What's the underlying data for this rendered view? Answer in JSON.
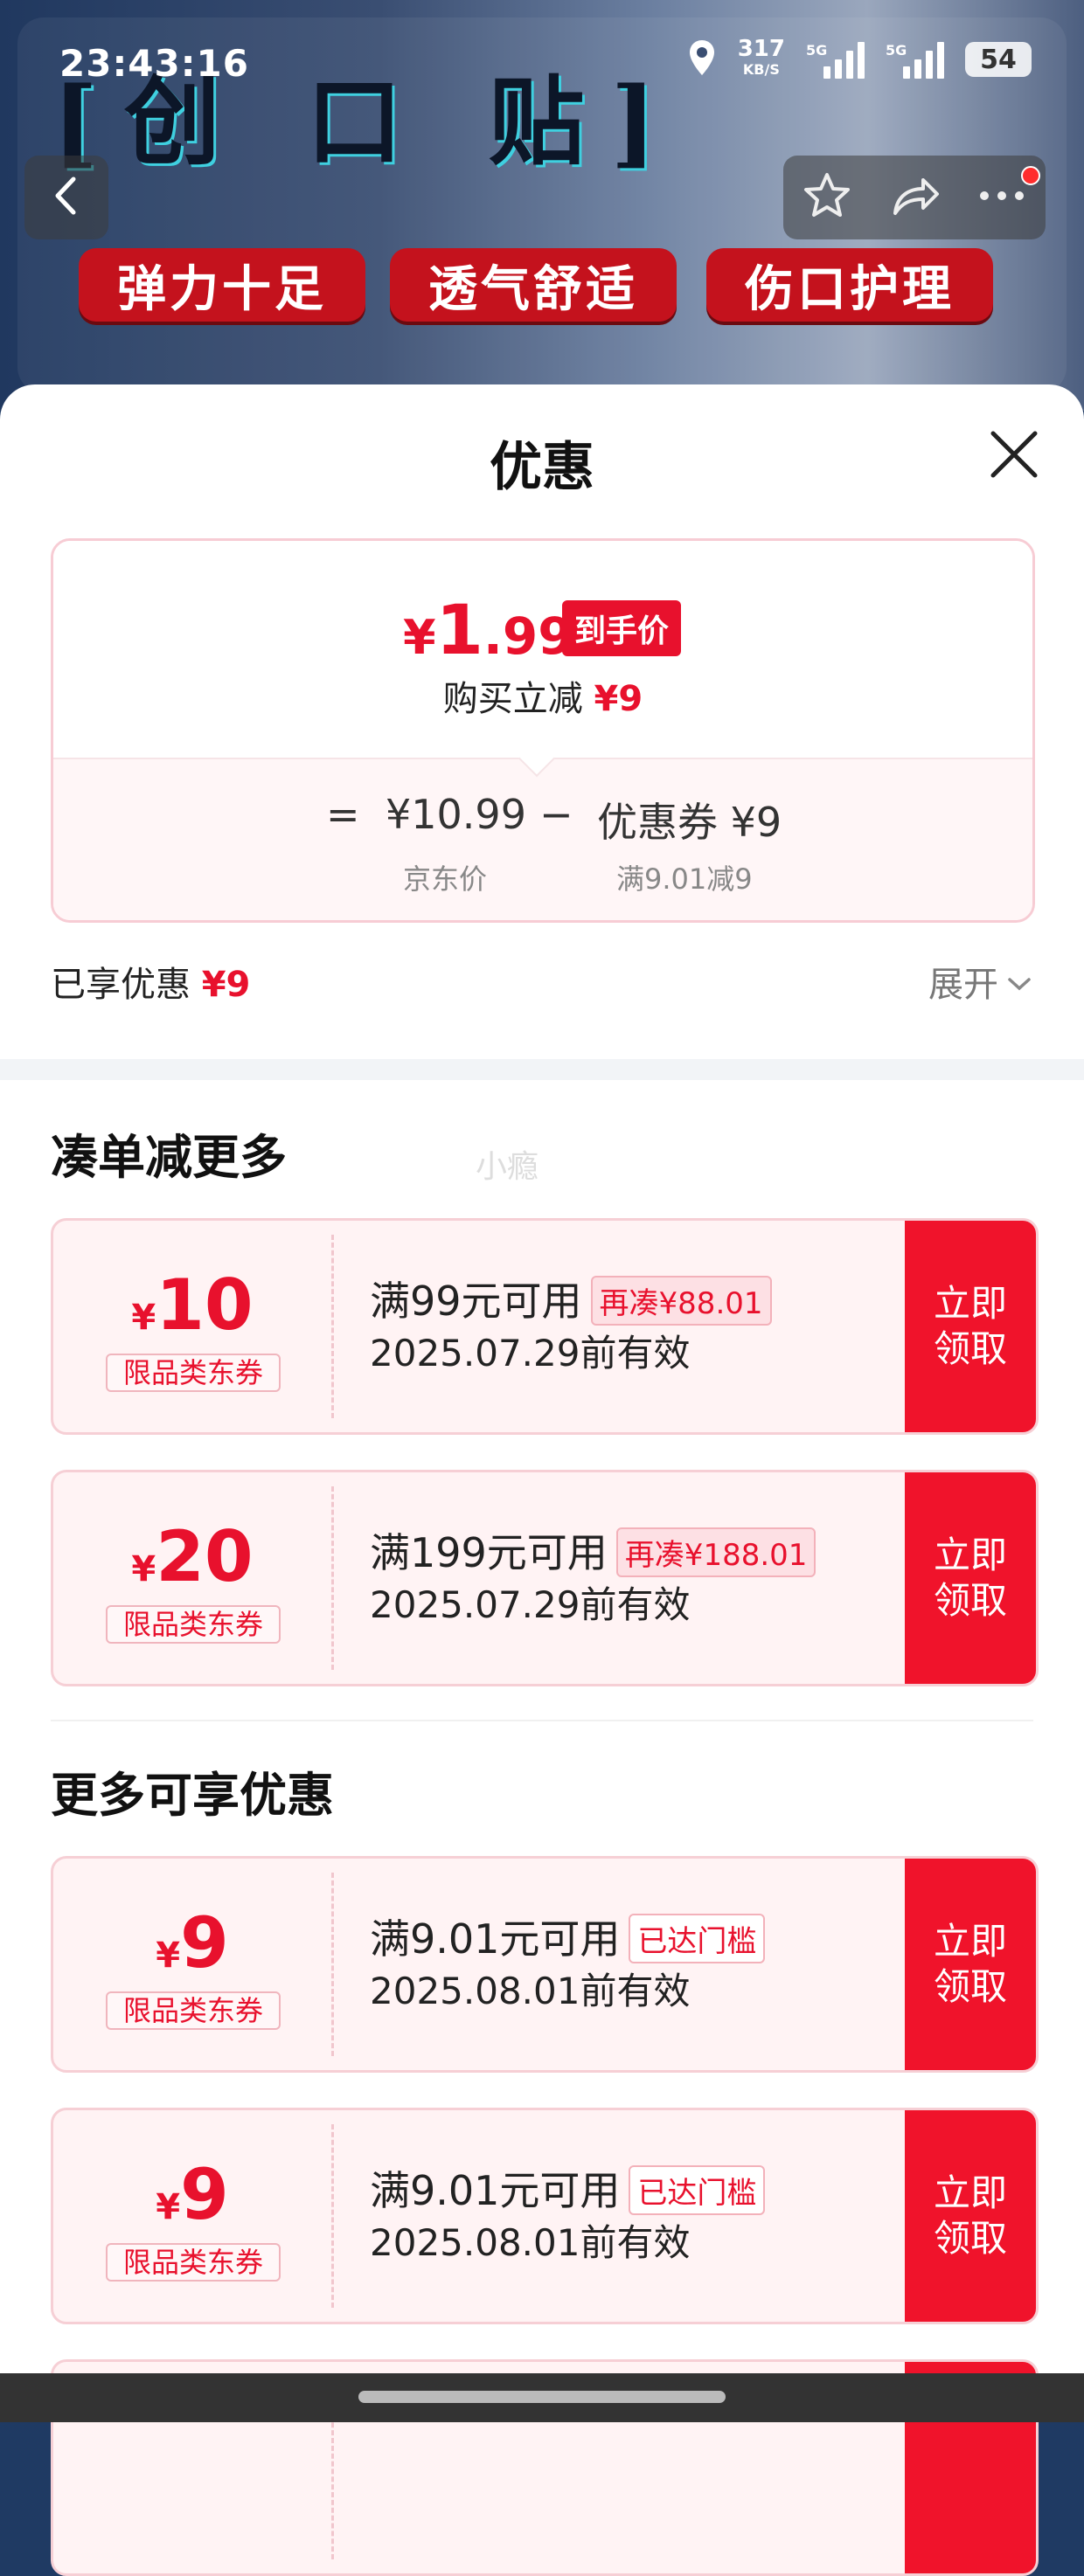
{
  "status_bar": {
    "time": "23:43:16",
    "speed_value": "317",
    "speed_unit": "KB/S",
    "net1": "5G",
    "net2": "5G",
    "battery": "54",
    "icons": [
      "location-icon",
      "signal-icon",
      "battery-icon"
    ]
  },
  "banner": {
    "title": "[创 口 贴]",
    "tags": [
      "弹力十足",
      "透气舒适",
      "伤口护理"
    ]
  },
  "nav": {
    "icons": [
      "back-icon",
      "star-icon",
      "share-icon",
      "more-icon"
    ]
  },
  "sheet": {
    "title": "优惠",
    "close_icon": "close-icon"
  },
  "price": {
    "symbol": "¥",
    "final_int": "1",
    "final_dec": ".99",
    "badge": "到手价",
    "reduce_label": "购买立减",
    "reduce_amount": "¥9",
    "equals": "=",
    "base_price": "¥10.99",
    "minus": "−",
    "coupon_part": "优惠券 ¥9",
    "base_label": "京东价",
    "coupon_rule": "满9.01减9"
  },
  "enjoyed": {
    "label": "已享优惠",
    "amount": "¥9",
    "expand": "展开"
  },
  "watermark": "小瘾",
  "section_more_order": "凑单减更多",
  "section_more_enjoy": "更多可享优惠",
  "coupons": [
    {
      "symbol": "¥",
      "amount": "10",
      "kind": "限品类东券",
      "condition": "满99元可用",
      "tip": "再凑¥88.01",
      "valid": "2025.07.29前有效",
      "claim": "立即领取"
    },
    {
      "symbol": "¥",
      "amount": "20",
      "kind": "限品类东券",
      "condition": "满199元可用",
      "tip": "再凑¥188.01",
      "valid": "2025.07.29前有效",
      "claim": "立即领取"
    },
    {
      "symbol": "¥",
      "amount": "9",
      "kind": "限品类东券",
      "condition": "满9.01元可用",
      "tip": "已达门槛",
      "valid": "2025.08.01前有效",
      "claim": "立即领取"
    },
    {
      "symbol": "¥",
      "amount": "9",
      "kind": "限品类东券",
      "condition": "满9.01元可用",
      "tip": "已达门槛",
      "valid": "2025.08.01前有效",
      "claim": "立即领取"
    }
  ],
  "colors": {
    "accent_red": "#e8112d",
    "claim_red": "#f0132b",
    "coupon_bg": "#fff3f4"
  }
}
